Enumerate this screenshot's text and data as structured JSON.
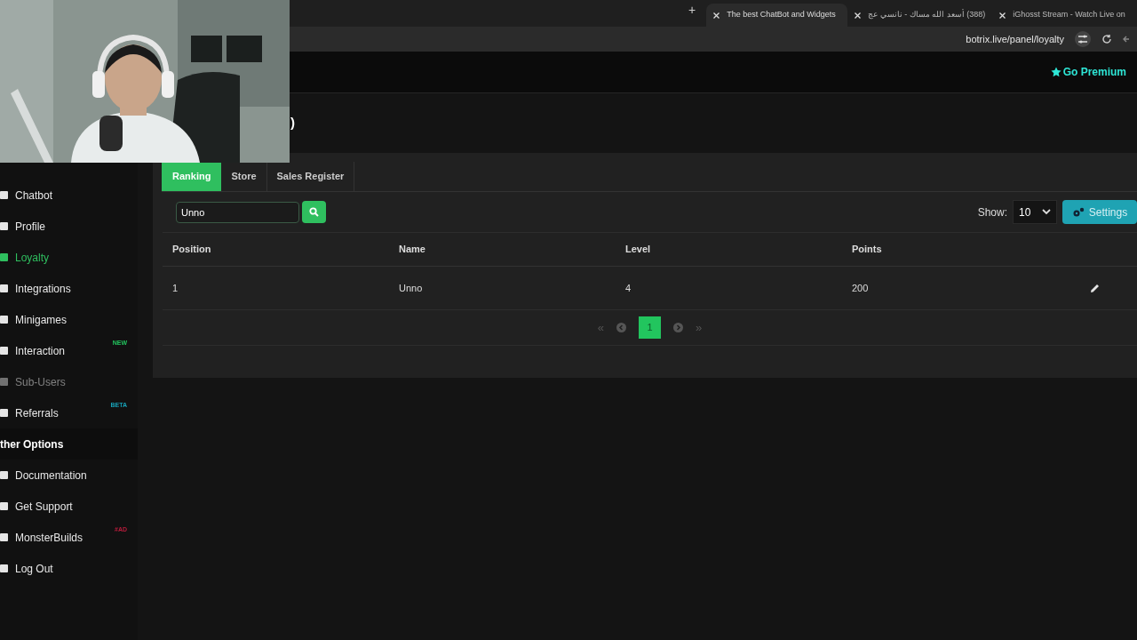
{
  "browser": {
    "new_tab": "+",
    "tabs": [
      {
        "title": "The best ChatBot and Widgets",
        "selected": true
      },
      {
        "title": "(388) أسعد الله مساك - نانسي عج",
        "selected": false
      },
      {
        "title": "iGhosst Stream - Watch Live on",
        "selected": false
      }
    ],
    "url": "botrix.live/panel/loyalty"
  },
  "header": {
    "premium": "Go Premium"
  },
  "page_title": ")",
  "sidebar": {
    "items": [
      {
        "label": "Chatbot",
        "selected": false,
        "disabled": false
      },
      {
        "label": "Profile",
        "selected": false,
        "disabled": false
      },
      {
        "label": "Loyalty",
        "selected": true,
        "disabled": false
      },
      {
        "label": "Integrations",
        "selected": false,
        "disabled": false
      },
      {
        "label": "Minigames",
        "selected": false,
        "disabled": false
      },
      {
        "label": "Interaction",
        "selected": false,
        "disabled": false,
        "badge": "NEW",
        "color": "#22c55e"
      },
      {
        "label": "Sub-Users",
        "selected": false,
        "disabled": true
      },
      {
        "label": "Referrals",
        "selected": false,
        "disabled": false,
        "badge": "BETA",
        "color": "#17a2b8"
      }
    ],
    "section": "ther Options",
    "other_items": [
      {
        "label": "Documentation",
        "selected": false,
        "disabled": false
      },
      {
        "label": "Get Support",
        "selected": false,
        "disabled": false
      },
      {
        "label": "MonsterBuilds",
        "selected": false,
        "disabled": false,
        "badge": "#AD",
        "color": "#b91c3c"
      },
      {
        "label": "Log Out",
        "selected": false,
        "disabled": false
      }
    ]
  },
  "tabs": [
    {
      "label": "Ranking",
      "selected": true
    },
    {
      "label": "Store",
      "selected": false
    },
    {
      "label": "Sales Register",
      "selected": false
    }
  ],
  "search": {
    "value": "Unno"
  },
  "show": {
    "label": "Show:",
    "value": "10"
  },
  "settings_button": "Settings",
  "table": {
    "columns": [
      "Position",
      "Name",
      "Level",
      "Points"
    ],
    "rows": [
      [
        "1",
        "Unno",
        "4",
        "200"
      ]
    ]
  },
  "pagination": {
    "first": "«",
    "last": "»",
    "pages": [
      {
        "label": "1",
        "selected": true
      }
    ]
  }
}
